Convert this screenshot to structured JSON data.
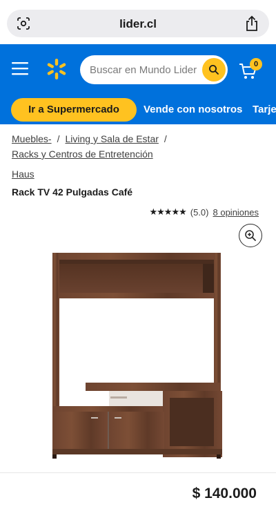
{
  "browser": {
    "url": "lider.cl"
  },
  "header": {
    "search_placeholder": "Buscar en Mundo Lider",
    "cart_count": "0",
    "colors": {
      "brand_blue": "#0071dc",
      "accent_yellow": "#ffc220"
    }
  },
  "subnav": {
    "items": [
      "Ir a Supermercado",
      "Vende con nosotros",
      "Tarjeta"
    ]
  },
  "breadcrumb": {
    "items": [
      "Muebles-",
      "Living y Sala de Estar",
      "Racks y Centros de Entretención"
    ]
  },
  "product": {
    "brand": "Haus",
    "title": "Rack TV 42 Pulgadas Café",
    "stars": "★★★★★",
    "rating_value": "(5.0)",
    "reviews_label": "8 opiniones",
    "price": "$ 140.000"
  },
  "icons": {
    "lens": "google-lens-icon",
    "share": "share-icon",
    "menu": "hamburger-menu-icon",
    "logo": "walmart-spark-icon",
    "search": "search-icon",
    "cart": "cart-icon",
    "zoom": "zoom-in-icon"
  }
}
